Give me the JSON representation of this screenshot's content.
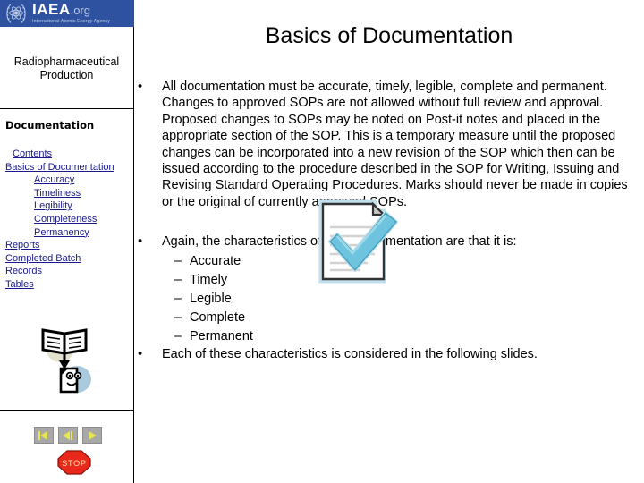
{
  "logo": {
    "emblem": "iaea-atom-emblem",
    "main": "IAEA",
    "org": ".org",
    "subtitle": "International Atomic Energy Agency",
    "bar_color": "#2f52a0"
  },
  "sidebar": {
    "course_title": "Radiopharmaceutical Production",
    "section_heading": "Documentation",
    "nav_items": [
      {
        "label": "Contents",
        "level": 1
      },
      {
        "label": "Basics of Documentation",
        "level": 0
      },
      {
        "label": "Accuracy",
        "level": 2
      },
      {
        "label": "Timeliness",
        "level": 2
      },
      {
        "label": "Legibility",
        "level": 2
      },
      {
        "label": "Completeness",
        "level": 2
      },
      {
        "label": "Permanency",
        "level": 2
      },
      {
        "label": "Reports",
        "level": 0
      },
      {
        "label": "Completed Batch",
        "level": 0
      },
      {
        "label": "Records",
        "level": 0
      },
      {
        "label": "Tables",
        "level": 0
      }
    ],
    "link_color": "#1a1a8c",
    "book_icon": "open-book-to-document-icon",
    "nav_buttons": [
      {
        "icon": "first-slide-icon"
      },
      {
        "icon": "previous-slide-icon"
      },
      {
        "icon": "next-slide-icon"
      }
    ],
    "stop_button": {
      "label": "STOP",
      "color": "#e8291c"
    }
  },
  "slide": {
    "title": "Basics of Documentation",
    "bullets": [
      {
        "mark": "•",
        "text": "All documentation must be accurate, timely, legible, complete and permanent.  Changes to approved SOPs are not allowed without full review and approval.  Proposed changes to SOPs may be noted on Post-it notes and placed in the appropriate section of the SOP.  This is a temporary measure until the proposed changes can be incorporated into a new revision of the SOP which then can be issued according to the procedure described in the SOP for Writing, Issuing and Revising Standard Operating Procedures.  Marks should never be made in copies or the original of currently approved SOPs."
      },
      {
        "mark": "•",
        "text": "Again, the characteristics of good documentation are that it is:"
      },
      {
        "mark": "•",
        "text": "Each of these characteristics is considered in the following slides."
      }
    ],
    "sub_bullets": [
      {
        "mark": "–",
        "text": "Accurate"
      },
      {
        "mark": "–",
        "text": "Timely"
      },
      {
        "mark": "–",
        "text": "Legible"
      },
      {
        "mark": "–",
        "text": "Complete"
      },
      {
        "mark": "–",
        "text": "Permanent"
      }
    ],
    "image": {
      "name": "document-with-checkmark-icon",
      "check_color": "#6ec4de",
      "page_color": "#ffffff"
    }
  }
}
